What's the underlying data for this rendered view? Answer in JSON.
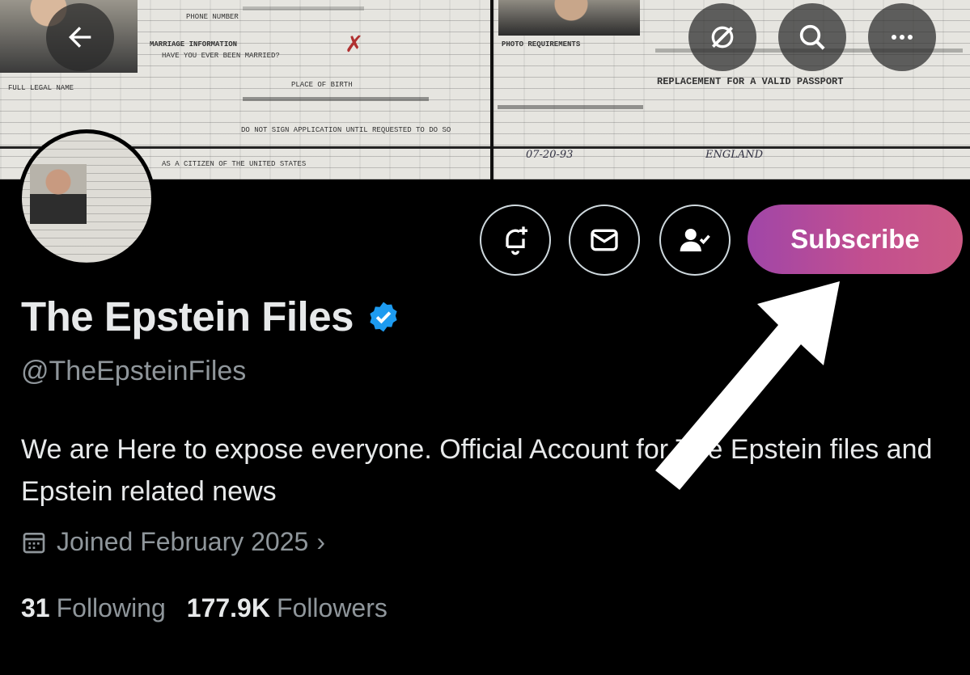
{
  "banner": {
    "doc_labels": [
      "PHONE NUMBER",
      "MARRIAGE INFORMATION",
      "HAVE YOU EVER BEEN MARRIED?",
      "PLACE OF BIRTH",
      "FULL LEGAL NAME",
      "DO NOT SIGN APPLICATION UNTIL REQUESTED TO DO SO",
      "AS A CITIZEN OF THE UNITED STATES",
      "PHOTO REQUIREMENTS",
      "REPLACEMENT FOR A VALID PASSPORT"
    ],
    "handwritten": {
      "date": "07-20-93",
      "place": "ENGLAND"
    }
  },
  "header_buttons": {
    "back": "back-arrow-icon",
    "grok": "grok-icon",
    "search": "search-icon",
    "more": "more-icon"
  },
  "actions": {
    "notify": "bell-plus-icon",
    "message": "envelope-icon",
    "follow": "person-check-icon",
    "subscribe_label": "Subscribe"
  },
  "profile": {
    "display_name": "The Epstein Files",
    "verified_color": "#1d9bf0",
    "handle": "@TheEpsteinFiles",
    "bio": "We are Here to expose everyone. Official Account for The Epstein files and Epstein related news",
    "joined": "Joined February 2025",
    "following_count": "31",
    "following_label": "Following",
    "followers_count": "177.9K",
    "followers_label": "Followers"
  },
  "colors": {
    "subscribe_gradient_start": "#a046a8",
    "subscribe_gradient_end": "#cc5a85",
    "background": "#000000",
    "secondary_text": "#8f969b"
  }
}
